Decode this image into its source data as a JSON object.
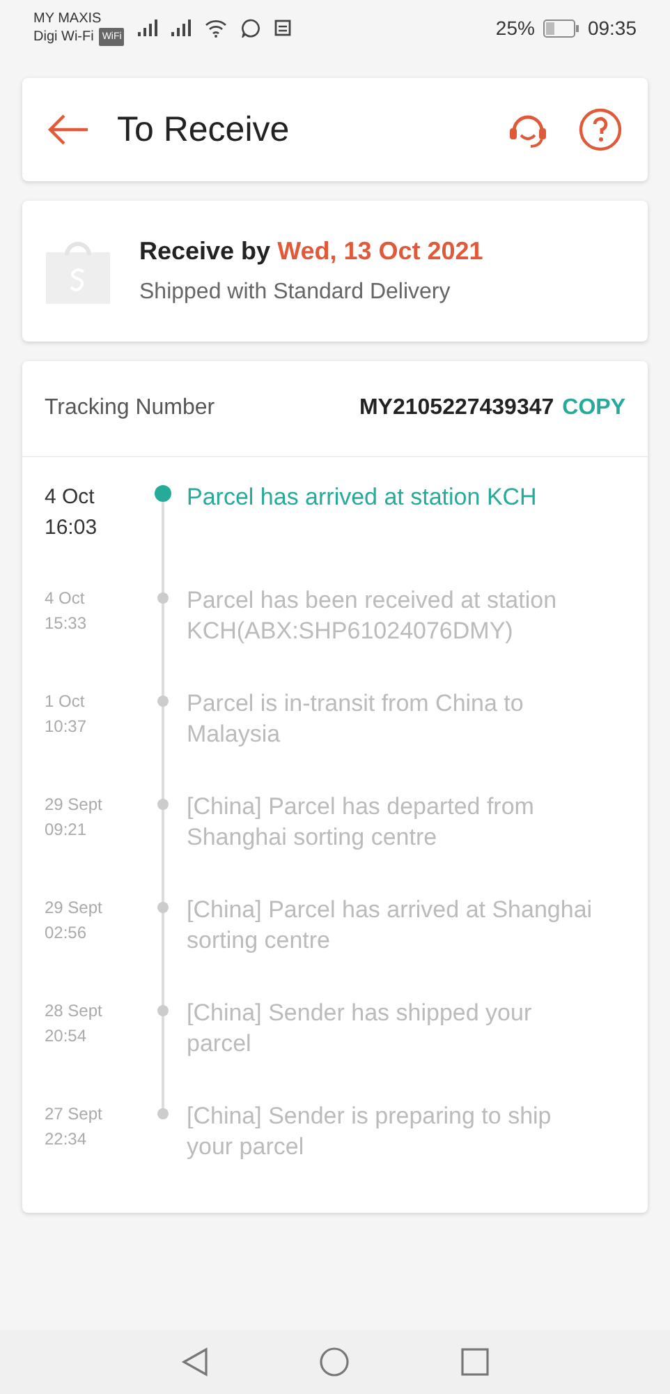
{
  "status_bar": {
    "carrier_1": "MY MAXIS",
    "carrier_2": "Digi Wi-Fi",
    "wifi_badge": "WiFi",
    "battery": "25%",
    "time": "09:35"
  },
  "header": {
    "title": "To Receive"
  },
  "delivery": {
    "label": "Receive by",
    "date": "Wed, 13 Oct 2021",
    "method": "Shipped with Standard Delivery"
  },
  "tracking": {
    "label": "Tracking Number",
    "number": "MY2105227439347",
    "copy": "COPY",
    "events": [
      {
        "date": "4 Oct",
        "time": "16:03",
        "text": "Parcel has arrived at station KCH",
        "current": true
      },
      {
        "date": "4 Oct",
        "time": "15:33",
        "text": "Parcel has been received at station KCH(ABX:SHP61024076DMY)",
        "current": false
      },
      {
        "date": "1 Oct",
        "time": "10:37",
        "text": "Parcel is in-transit from China to Malaysia",
        "current": false
      },
      {
        "date": "29 Sept",
        "time": "09:21",
        "text": "[China] Parcel has departed from Shanghai sorting centre",
        "current": false
      },
      {
        "date": "29 Sept",
        "time": "02:56",
        "text": "[China] Parcel has arrived at Shanghai sorting centre",
        "current": false
      },
      {
        "date": "28 Sept",
        "time": "20:54",
        "text": "[China] Sender has shipped your parcel",
        "current": false
      },
      {
        "date": "27 Sept",
        "time": "22:34",
        "text": "[China] Sender is preparing to ship your parcel",
        "current": false
      }
    ]
  }
}
